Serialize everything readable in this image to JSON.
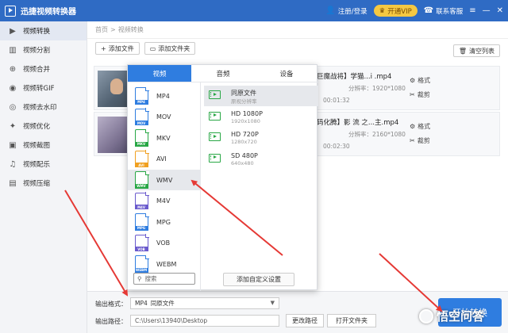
{
  "app": {
    "title": "迅捷视频转换器"
  },
  "titlebar": {
    "login": "注册/登录",
    "vip": "开通VIP",
    "support": "联系客服"
  },
  "sidebar": {
    "items": [
      {
        "label": "视频转换",
        "icon": "play-icon"
      },
      {
        "label": "视频分割",
        "icon": "split-icon"
      },
      {
        "label": "视频合并",
        "icon": "merge-icon"
      },
      {
        "label": "视频转GIF",
        "icon": "gif-icon"
      },
      {
        "label": "视频去水印",
        "icon": "watermark-icon"
      },
      {
        "label": "视频优化",
        "icon": "optimize-icon"
      },
      {
        "label": "视频截图",
        "icon": "screenshot-icon"
      },
      {
        "label": "视频配乐",
        "icon": "music-icon"
      },
      {
        "label": "视频压缩",
        "icon": "compress-icon"
      }
    ]
  },
  "breadcrumb": {
    "home": "首页",
    "sep": ">",
    "current": "视频转换"
  },
  "toolbar": {
    "add_file": "添加文件",
    "add_folder": "添加文件夹",
    "clear_list": "清空列表"
  },
  "files": [
    {
      "name": "巨魔战将】学猫...i .mp4",
      "resolution": "分辨率：1920*1080",
      "duration": "00:01:32",
      "format_label": "格式",
      "cut_label": "裁剪"
    },
    {
      "name": "码化腾】影 流 之...主.mp4",
      "resolution": "分辨率：2160*1080",
      "duration": "00:02:30",
      "format_label": "格式",
      "cut_label": "裁剪"
    }
  ],
  "popup": {
    "tabs": [
      "视频",
      "音频",
      "设备"
    ],
    "formats": [
      {
        "name": "MP4",
        "color": "#2f7de0"
      },
      {
        "name": "MOV",
        "color": "#2f7de0"
      },
      {
        "name": "MKV",
        "color": "#28a745"
      },
      {
        "name": "AVI",
        "color": "#f0a020"
      },
      {
        "name": "WMV",
        "color": "#28a745"
      },
      {
        "name": "M4V",
        "color": "#6a5acd"
      },
      {
        "name": "MPG",
        "color": "#2f7de0"
      },
      {
        "name": "VOB",
        "color": "#6a5acd"
      },
      {
        "name": "WEBM",
        "color": "#2f7de0"
      }
    ],
    "search_placeholder": "搜索",
    "qualities": [
      {
        "name": "同原文件",
        "sub": "原视分辨率"
      },
      {
        "name": "HD 1080P",
        "sub": "1920x1080"
      },
      {
        "name": "HD 720P",
        "sub": "1280x720"
      },
      {
        "name": "SD 480P",
        "sub": "640x480"
      }
    ],
    "add_custom": "添加自定义设置"
  },
  "bottom": {
    "format_label": "输出格式：",
    "format_value": "MP4",
    "format_sub": "同原文件",
    "path_label": "输出路径：",
    "path_value": "C:\\Users\\13940\\Desktop",
    "change_path": "更改路径",
    "open_folder": "打开文件夹",
    "start": "开始转换"
  },
  "watermark": "悟空问答",
  "colors": {
    "brand": "#2f6bc4",
    "accent": "#2f7de0",
    "arrow": "#e53935",
    "vip": "#f5c842"
  }
}
